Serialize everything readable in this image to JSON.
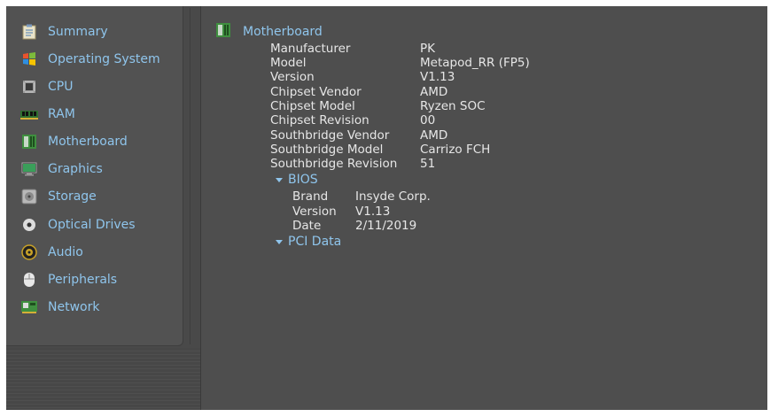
{
  "sidebar": {
    "items": [
      {
        "label": "Summary",
        "icon": "clipboard-icon"
      },
      {
        "label": "Operating System",
        "icon": "windows-logo-icon"
      },
      {
        "label": "CPU",
        "icon": "chip-icon"
      },
      {
        "label": "RAM",
        "icon": "ram-icon"
      },
      {
        "label": "Motherboard",
        "icon": "motherboard-icon"
      },
      {
        "label": "Graphics",
        "icon": "monitor-icon"
      },
      {
        "label": "Storage",
        "icon": "hard-drive-icon"
      },
      {
        "label": "Optical Drives",
        "icon": "disc-icon"
      },
      {
        "label": "Audio",
        "icon": "speaker-icon"
      },
      {
        "label": "Peripherals",
        "icon": "mouse-icon"
      },
      {
        "label": "Network",
        "icon": "network-card-icon"
      }
    ]
  },
  "main": {
    "title": "Motherboard",
    "properties": [
      {
        "key": "Manufacturer",
        "value": "PK"
      },
      {
        "key": "Model",
        "value": "Metapod_RR (FP5)"
      },
      {
        "key": "Version",
        "value": "V1.13"
      },
      {
        "key": "Chipset Vendor",
        "value": "AMD"
      },
      {
        "key": "Chipset Model",
        "value": "Ryzen SOC"
      },
      {
        "key": "Chipset Revision",
        "value": "00"
      },
      {
        "key": "Southbridge Vendor",
        "value": "AMD"
      },
      {
        "key": "Southbridge Model",
        "value": "Carrizo FCH"
      },
      {
        "key": "Southbridge Revision",
        "value": "51"
      }
    ],
    "bios": {
      "label": "BIOS",
      "properties": [
        {
          "key": "Brand",
          "value": "Insyde Corp."
        },
        {
          "key": "Version",
          "value": "V1.13"
        },
        {
          "key": "Date",
          "value": "2/11/2019"
        }
      ]
    },
    "pci": {
      "label": "PCI Data"
    }
  },
  "colors": {
    "accent": "#8fc5ec",
    "text": "#e6e6e6",
    "background": "#4e4e4e"
  }
}
